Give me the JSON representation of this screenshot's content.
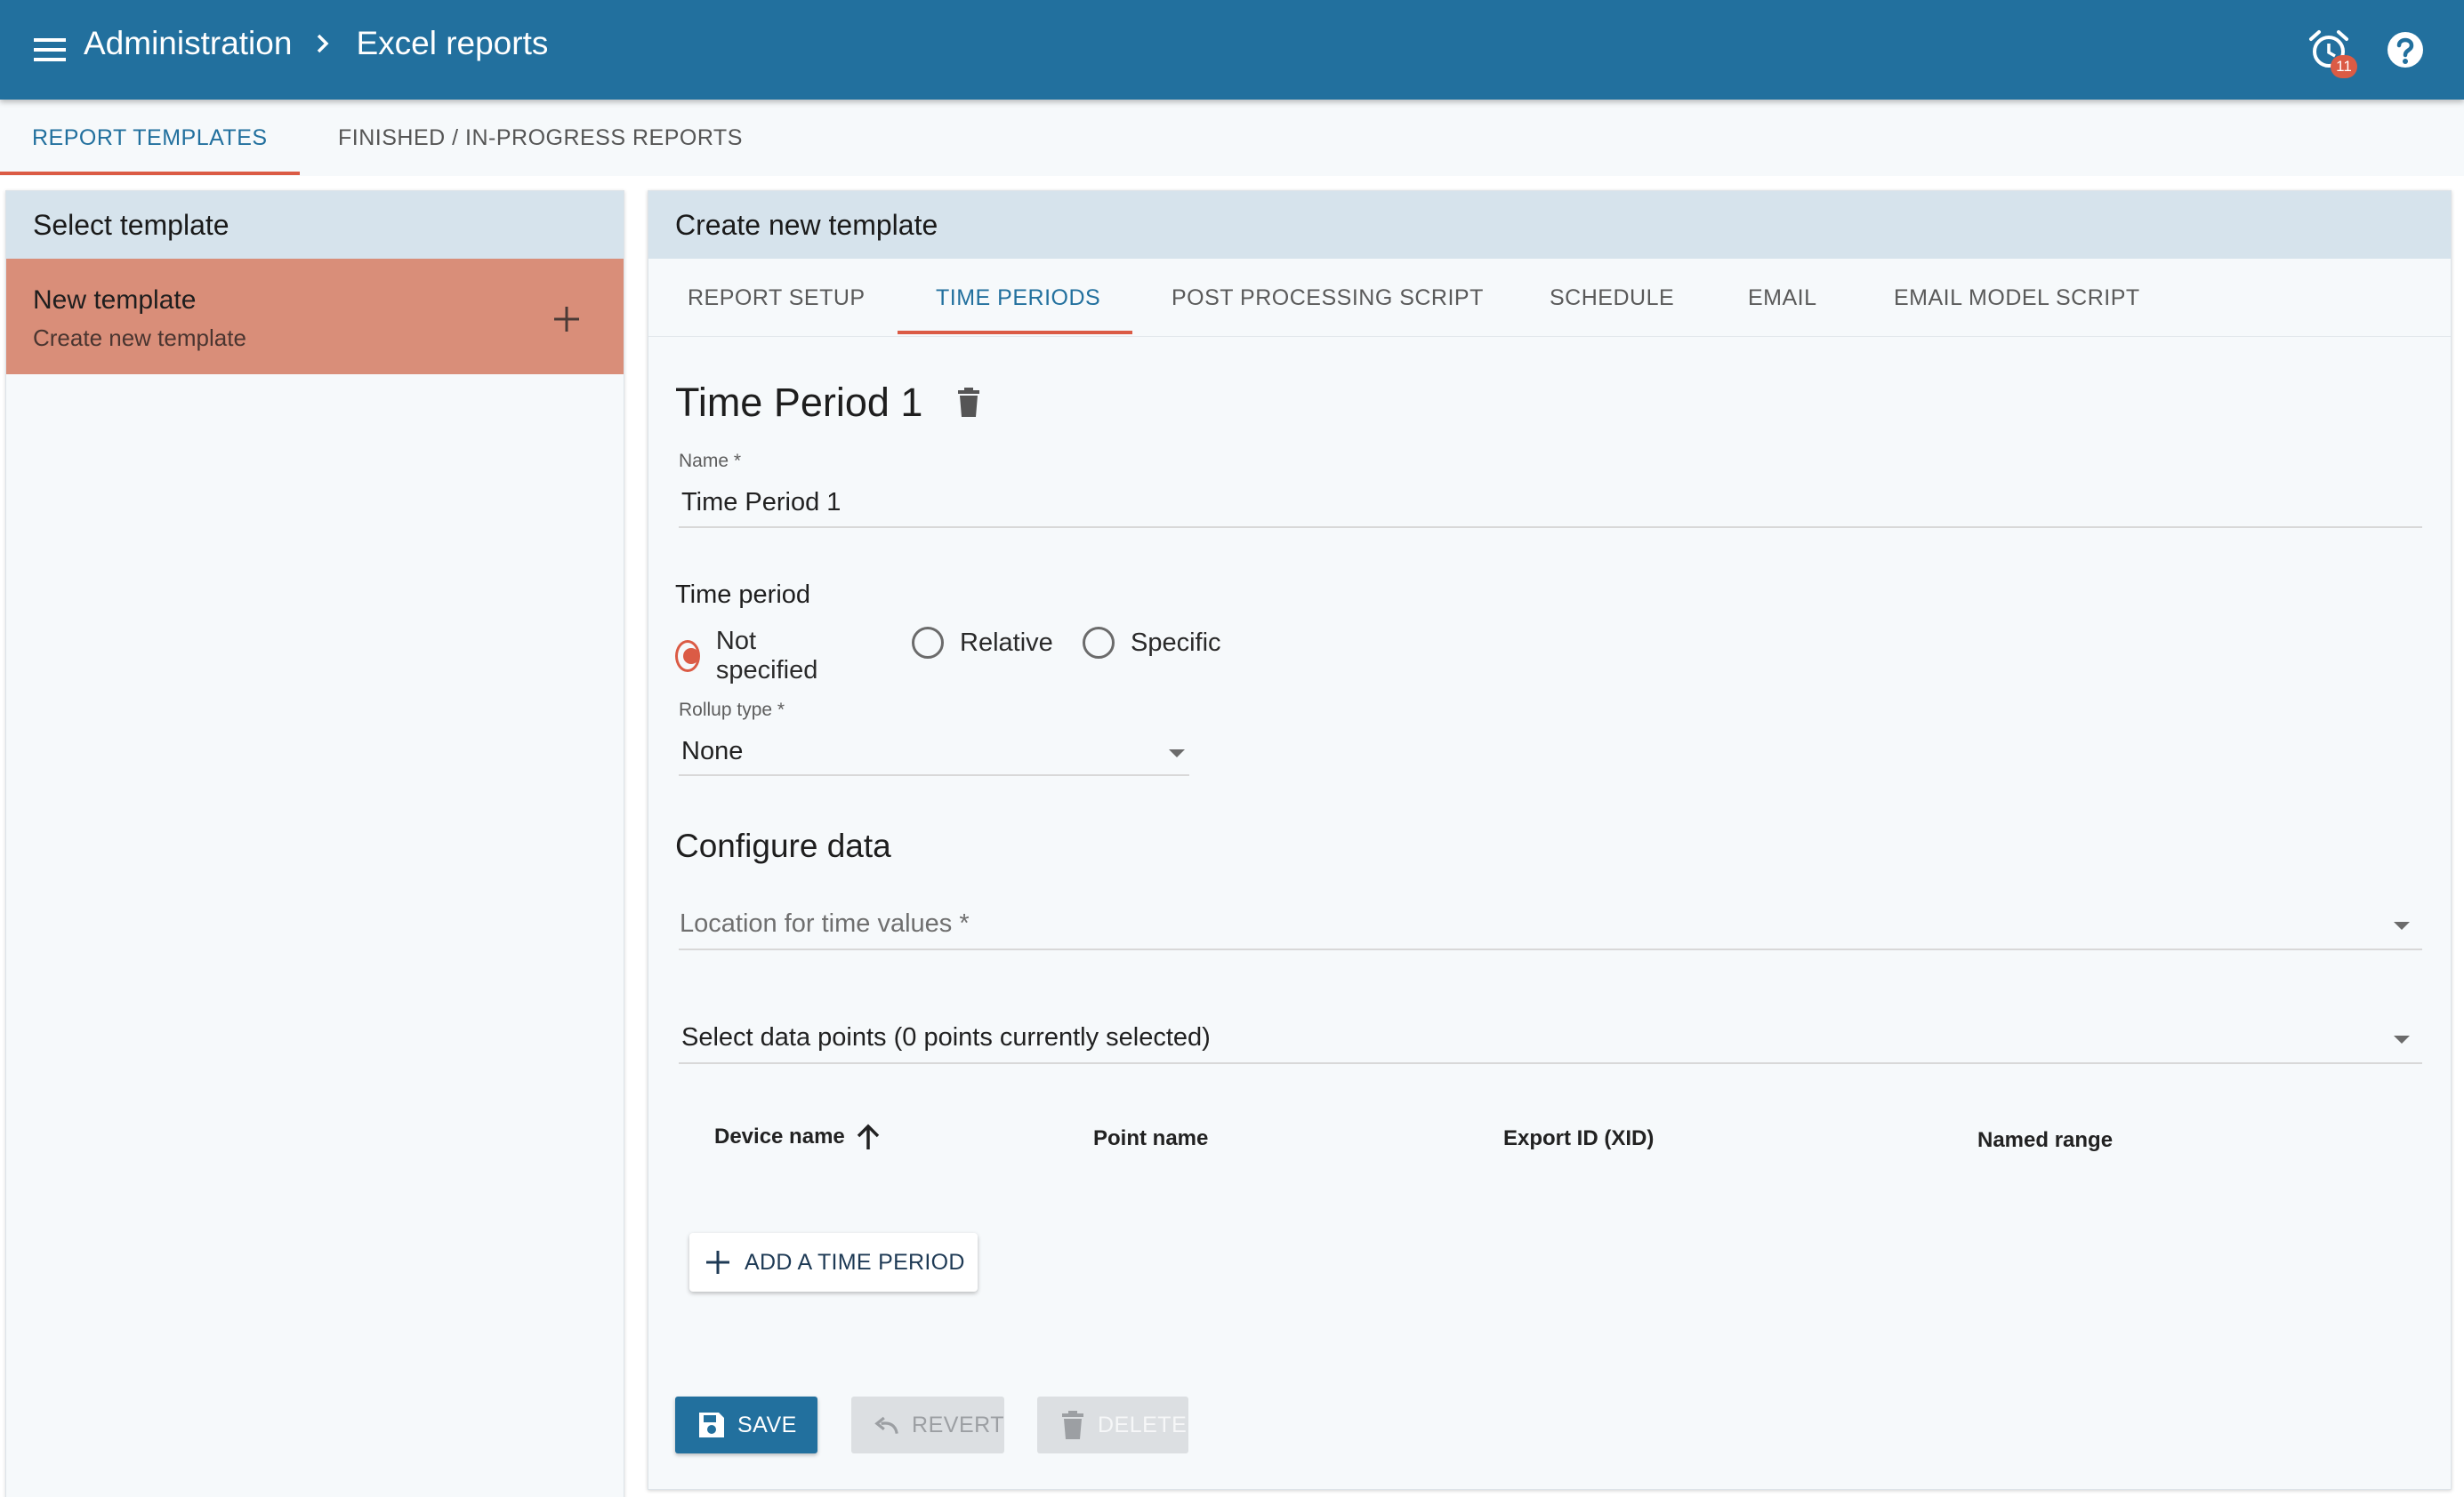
{
  "breadcrumb": {
    "root": "Administration",
    "current": "Excel reports"
  },
  "alerts": {
    "count": "11"
  },
  "main_tabs": [
    {
      "label": "REPORT TEMPLATES",
      "active": true
    },
    {
      "label": "FINISHED / IN-PROGRESS REPORTS",
      "active": false
    }
  ],
  "left_panel": {
    "title": "Select template",
    "item": {
      "title": "New template",
      "subtitle": "Create new template"
    }
  },
  "right_panel": {
    "title": "Create new template",
    "tabs": [
      {
        "label": "REPORT SETUP",
        "active": false
      },
      {
        "label": "TIME PERIODS",
        "active": true
      },
      {
        "label": "POST PROCESSING SCRIPT",
        "active": false
      },
      {
        "label": "SCHEDULE",
        "active": false
      },
      {
        "label": "EMAIL",
        "active": false
      },
      {
        "label": "EMAIL MODEL SCRIPT",
        "active": false
      }
    ]
  },
  "time_period": {
    "heading": "Time Period 1",
    "name_label": "Name *",
    "name_value": "Time Period 1",
    "section_label": "Time period",
    "options": [
      {
        "label": "Not specified",
        "checked": true
      },
      {
        "label": "Relative",
        "checked": false
      },
      {
        "label": "Specific",
        "checked": false
      }
    ],
    "rollup_label": "Rollup type *",
    "rollup_value": "None"
  },
  "configure": {
    "title": "Configure data",
    "location_placeholder": "Location for time values *",
    "data_points": "Select data points (0 points currently selected)",
    "columns": [
      "Device name",
      "Point name",
      "Export ID (XID)",
      "Named range"
    ],
    "sort_column": "Device name"
  },
  "buttons": {
    "add_time_period": "ADD A TIME PERIOD",
    "save": "SAVE",
    "revert": "REVERT",
    "delete": "DELETE"
  },
  "colors": {
    "app_bar": "#22709e",
    "accent": "#db5b45",
    "selected_item": "#d98e79",
    "panel_header": "#d6e3ec"
  }
}
